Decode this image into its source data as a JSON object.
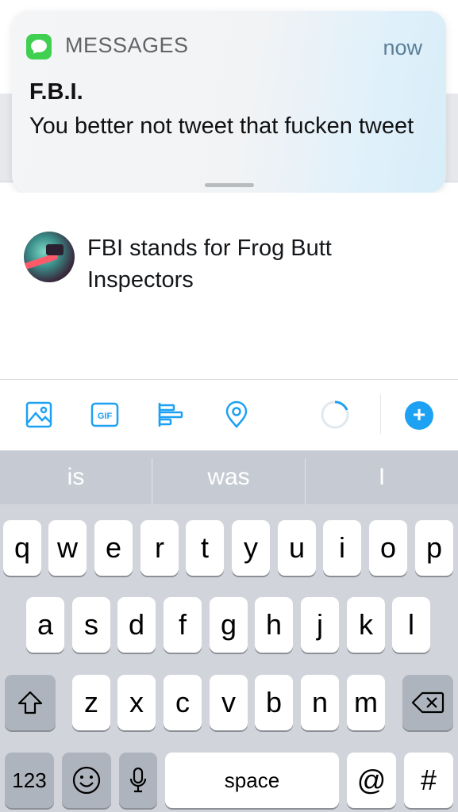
{
  "notification": {
    "app_name": "MESSAGES",
    "time": "now",
    "title": "F.B.I.",
    "body": "You better not tweet that fucken tweet"
  },
  "compose": {
    "text": "FBI stands for Frog Butt Inspectors"
  },
  "toolbar": {
    "icons": [
      "image-icon",
      "gif-icon",
      "poll-icon",
      "location-icon"
    ],
    "gif_label": "GIF",
    "add_label": "+"
  },
  "keyboard": {
    "suggestions": [
      "is",
      "was",
      "I"
    ],
    "row1": [
      "q",
      "w",
      "e",
      "r",
      "t",
      "y",
      "u",
      "i",
      "o",
      "p"
    ],
    "row2": [
      "a",
      "s",
      "d",
      "f",
      "g",
      "h",
      "j",
      "k",
      "l"
    ],
    "row3": [
      "z",
      "x",
      "c",
      "v",
      "b",
      "n",
      "m"
    ],
    "numbers_label": "123",
    "space_label": "space",
    "at_label": "@",
    "hash_label": "#"
  },
  "colors": {
    "accent": "#1da1f2",
    "messages_green": "#3fd052",
    "keyboard_bg": "#d1d5db"
  }
}
